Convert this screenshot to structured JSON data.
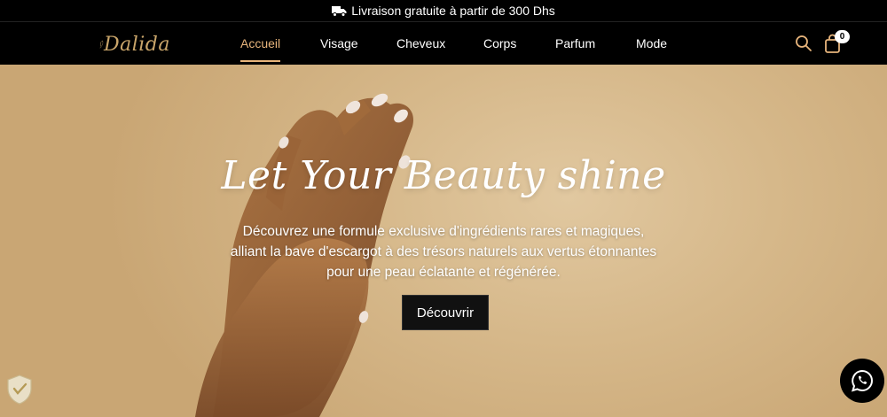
{
  "announcement": {
    "icon": "truck-icon",
    "text": "Livraison gratuite à partir de 300 Dhs"
  },
  "header": {
    "logo_text": "Dalida",
    "nav": [
      {
        "label": "Accueil",
        "active": true
      },
      {
        "label": "Visage",
        "active": false
      },
      {
        "label": "Cheveux",
        "active": false
      },
      {
        "label": "Corps",
        "active": false
      },
      {
        "label": "Parfum",
        "active": false
      },
      {
        "label": "Mode",
        "active": false
      }
    ],
    "search_icon": "search-icon",
    "cart_icon": "shopping-bag-icon",
    "cart_count": "0"
  },
  "hero": {
    "title": "Let Your Beauty shine",
    "description_lines": [
      "Découvrez une formule exclusive d'ingrédients rares et magiques,",
      "alliant la bave d'escargot à des trésors naturels aux vertus étonnantes",
      "pour une peau éclatante et régénérée."
    ],
    "cta_label": "Découvrir"
  },
  "floating": {
    "whatsapp_icon": "whatsapp-icon",
    "badge_icon": "trust-badge-icon"
  },
  "colors": {
    "accent": "#e8b57c",
    "background": "#000000",
    "hero_tone": "#d6b88a"
  }
}
